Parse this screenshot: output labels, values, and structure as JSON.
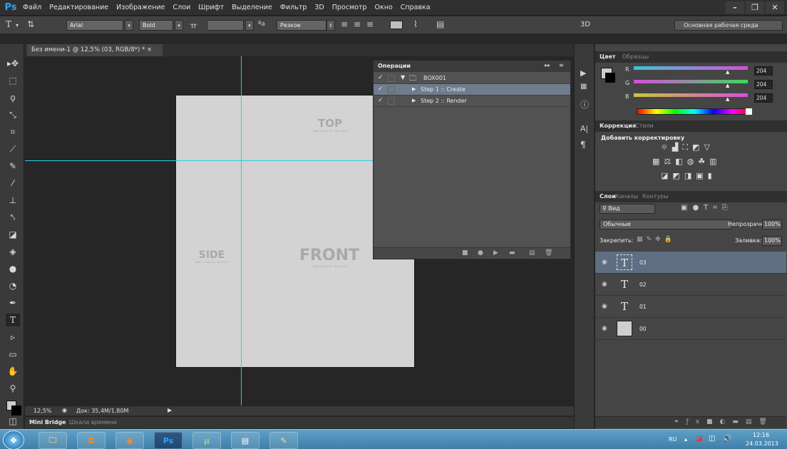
{
  "app": {
    "logo": "Ps",
    "menu": [
      "Файл",
      "Редактирование",
      "Изображение",
      "Слои",
      "Шрифт",
      "Выделение",
      "Фильтр",
      "3D",
      "Просмотр",
      "Окно",
      "Справка"
    ],
    "window_controls": [
      "–",
      "❐",
      "✕"
    ]
  },
  "options_bar": {
    "font_family": "Arial",
    "font_style": "Bold",
    "size_value": "",
    "antialias": "Резкое",
    "btn_3d": "3D",
    "workspace": "Основная рабочая среда",
    "tool_icon": "type-tool-icon"
  },
  "document": {
    "tab_title": "Без имени-1 @ 12,5% (03, RGB/8*) * ×",
    "top_label": "TOP",
    "top_sub": "2480 X 2480 PX · 90 X 90 M",
    "side_label": "SIDE",
    "side_sub": "2480 X 2480 PX · 90 X 90 M",
    "front_label": "FRONT",
    "front_sub": "2480 X 2480 PX · 90 X 90 M"
  },
  "status": {
    "zoom": "12,5%",
    "doc": "Док: 35,4M/1,80M",
    "tab_minibridge": "Mini Bridge",
    "tab_timeline": "Шкала времени"
  },
  "actions_panel": {
    "title": "Операции",
    "items": [
      {
        "label": "BOX001",
        "check": "✓",
        "kind": "folder",
        "selected": false
      },
      {
        "label": "Step 1 :: Create",
        "check": "✓",
        "kind": "action",
        "selected": true
      },
      {
        "label": "Step 2 :: Render",
        "check": "✓",
        "kind": "action",
        "selected": false
      }
    ]
  },
  "color_panel": {
    "tabs": [
      "Цвет",
      "Образцы"
    ],
    "channels": [
      {
        "name": "R",
        "value": "204"
      },
      {
        "name": "G",
        "value": "204"
      },
      {
        "name": "B",
        "value": "204"
      }
    ],
    "colors": {
      "r_track": "#d94ed9",
      "g_track": "#3ec3d8",
      "b_track": "#c8c83a"
    }
  },
  "adjustments_panel": {
    "tabs": [
      "Коррекция",
      "Стили"
    ],
    "heading": "Добавить корректировку"
  },
  "layers_panel": {
    "tabs": [
      "Слои",
      "Каналы",
      "Контуры"
    ],
    "filter": "Вид",
    "blend_mode": "Обычные",
    "opacity_label": "Непрозрачность:",
    "opacity_value": "100%",
    "lock_label": "Закрепить:",
    "fill_label": "Заливка:",
    "fill_value": "100%",
    "layers": [
      {
        "name": "03",
        "type": "text",
        "selected": true
      },
      {
        "name": "02",
        "type": "text",
        "selected": false
      },
      {
        "name": "01",
        "type": "text",
        "selected": false
      },
      {
        "name": "00",
        "type": "fill",
        "selected": false
      }
    ]
  },
  "taskbar": {
    "apps": [
      "explorer",
      "outlook",
      "firefox",
      "Ps",
      "utorrent",
      "word",
      "paint"
    ],
    "lang": "RU",
    "time": "12:16",
    "date": "24.03.2013"
  }
}
